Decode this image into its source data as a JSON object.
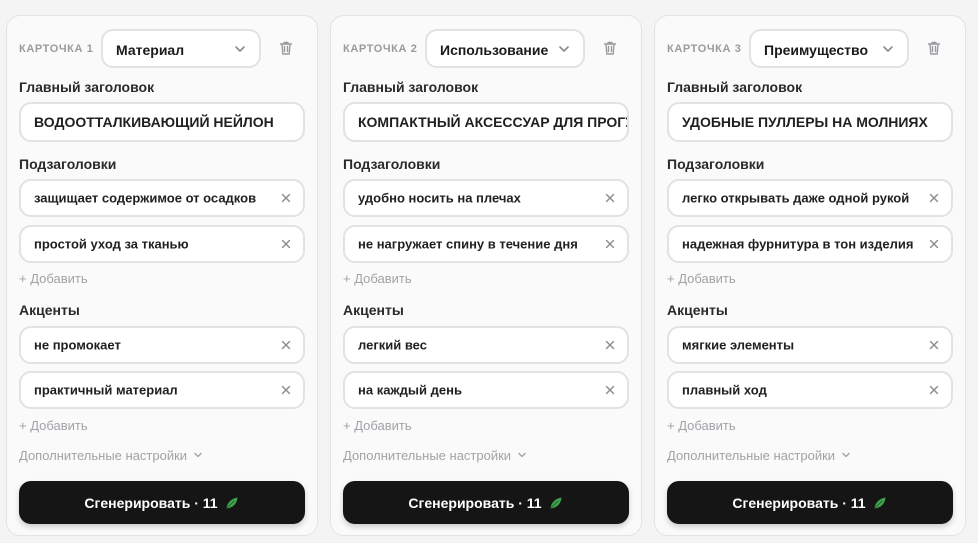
{
  "cards": [
    {
      "number": "КАРТОЧКА 1",
      "type": "Материал",
      "main_title_label": "Главный заголовок",
      "main_title": "ВОДООТТАЛКИВАЮЩИЙ НЕЙЛОН",
      "subtitles_label": "Подзаголовки",
      "subtitles": [
        "защищает содержимое от осадков",
        "простой уход за тканью"
      ],
      "add_label": "+ Добавить",
      "accents_label": "Акценты",
      "accents": [
        "не промокает",
        "практичный материал"
      ],
      "advanced_label": "Дополнительные настройки",
      "generate_label": "Сгенерировать · 11"
    },
    {
      "number": "КАРТОЧКА 2",
      "type": "Использование",
      "main_title_label": "Главный заголовок",
      "main_title": "КОМПАКТНЫЙ АКСЕССУАР ДЛЯ ПРОГУЛОК",
      "subtitles_label": "Подзаголовки",
      "subtitles": [
        "удобно носить на плечах",
        "не нагружает спину в течение дня"
      ],
      "add_label": "+ Добавить",
      "accents_label": "Акценты",
      "accents": [
        "легкий вес",
        "на каждый день"
      ],
      "advanced_label": "Дополнительные настройки",
      "generate_label": "Сгенерировать · 11"
    },
    {
      "number": "КАРТОЧКА 3",
      "type": "Преимущество",
      "main_title_label": "Главный заголовок",
      "main_title": "УДОБНЫЕ ПУЛЛЕРЫ НА МОЛНИЯХ",
      "subtitles_label": "Подзаголовки",
      "subtitles": [
        "легко открывать даже одной рукой",
        "надежная фурнитура в тон изделия"
      ],
      "add_label": "+ Добавить",
      "accents_label": "Акценты",
      "accents": [
        "мягкие элементы",
        "плавный ход"
      ],
      "advanced_label": "Дополнительные настройки",
      "generate_label": "Сгенерировать · 11"
    }
  ],
  "icons": {
    "type_select": "chevron-down-icon",
    "delete": "trash-icon",
    "remove": "close-icon",
    "advanced": "chevron-down-icon",
    "generate": "leaf-icon"
  },
  "colors": {
    "button_bg": "#151515",
    "leaf": "#3fa34d",
    "muted": "#a2a2a8"
  }
}
